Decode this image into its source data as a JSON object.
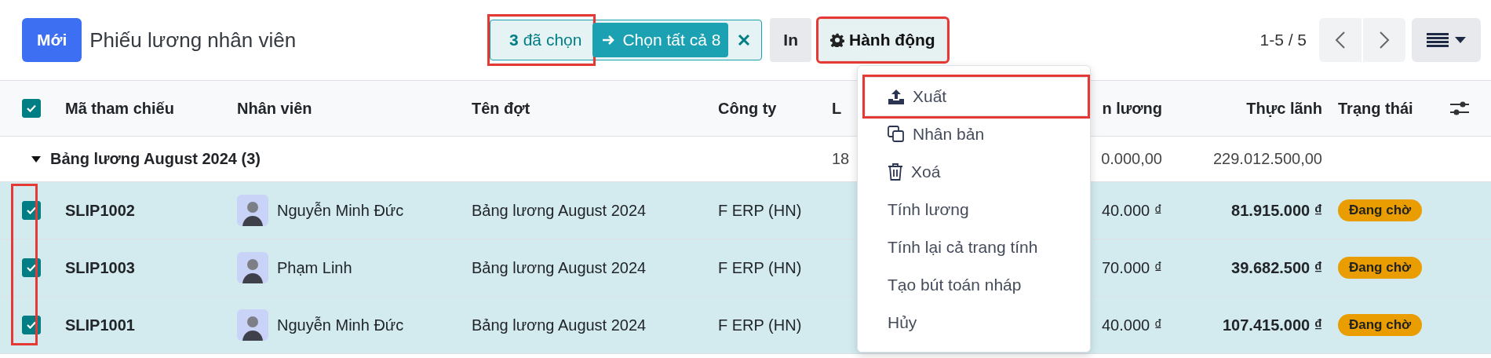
{
  "toolbar": {
    "new_button": "Mới",
    "title": "Phiếu lương nhân viên",
    "selection": {
      "count": "3",
      "label": "đã chọn",
      "highlighted": true,
      "select_all": "Chọn tất cả 8"
    },
    "print_button": "In",
    "actions_button": {
      "label": "Hành động",
      "highlighted": true
    },
    "pager": "1-5 / 5"
  },
  "actions_menu": {
    "items": [
      {
        "label": "Xuất",
        "kind": "export",
        "highlighted": true
      },
      {
        "label": "Nhân bản",
        "kind": "duplicate",
        "highlighted": false
      },
      {
        "label": "Xoá",
        "kind": "delete",
        "highlighted": false
      },
      {
        "label": "Tính lương",
        "kind": "plain",
        "highlighted": false
      },
      {
        "label": "Tính lại cả trang tính",
        "kind": "plain",
        "highlighted": false
      },
      {
        "label": "Tạo bút toán nháp",
        "kind": "plain",
        "highlighted": false
      },
      {
        "label": "Hủy",
        "kind": "plain",
        "highlighted": false
      }
    ]
  },
  "table": {
    "all_checked": true,
    "checkbox_column_highlighted": true,
    "columns": [
      "Mã tham chiếu",
      "Nhân viên",
      "Tên đợt",
      "Công ty",
      "L",
      "n lương",
      "Thực lãnh",
      "Trạng thái"
    ],
    "group": {
      "label": "Bảng lương August 2024 (3)",
      "expanded": true,
      "column_6": "18",
      "column_7": "0.000,00",
      "net": "229.012.500,00"
    },
    "rows": [
      {
        "selected": true,
        "ref": "SLIP1002",
        "employee": "Nguyễn Minh Đức",
        "batch": "Bảng lương August 2024",
        "company": "F ERP (HN)",
        "column_7": "40.000 ₫",
        "net": "81.915.000 ₫",
        "status": "Đang chờ"
      },
      {
        "selected": true,
        "ref": "SLIP1003",
        "employee": "Phạm Linh",
        "batch": "Bảng lương August 2024",
        "company": "F ERP (HN)",
        "column_7": "70.000 ₫",
        "net": "39.682.500 ₫",
        "status": "Đang chờ"
      },
      {
        "selected": true,
        "ref": "SLIP1001",
        "employee": "Nguyễn Minh Đức",
        "batch": "Bảng lương August 2024",
        "company": "F ERP (HN)",
        "column_7": "40.000 ₫",
        "net": "107.415.000 ₫",
        "status": "Đang chờ"
      }
    ]
  }
}
